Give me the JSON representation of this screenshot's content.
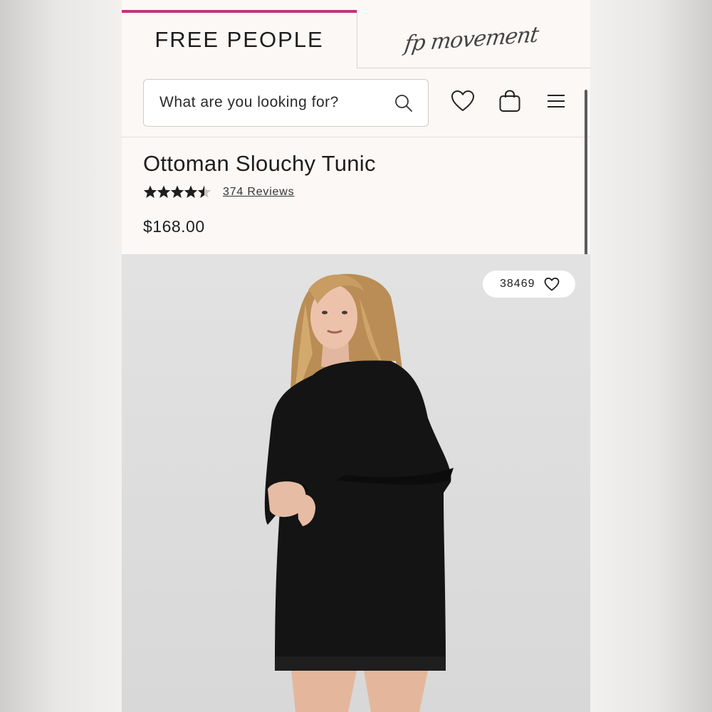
{
  "brand_tabs": {
    "active": "FREE PEOPLE",
    "secondary": "fp movement"
  },
  "search": {
    "placeholder": "What are you looking for?"
  },
  "header_icons": [
    "search-icon",
    "heart-icon",
    "bag-icon",
    "menu-icon"
  ],
  "product": {
    "title": "Ottoman Slouchy Tunic",
    "rating": 4.5,
    "rating_max": 5,
    "reviews_label": "374 Reviews",
    "price": "$168.00"
  },
  "photo": {
    "favorites_count": "38469"
  },
  "colors": {
    "accent": "#c2327a",
    "page_bg": "#fbf8f6",
    "text": "#1e1e1e",
    "garment": "#141414"
  }
}
